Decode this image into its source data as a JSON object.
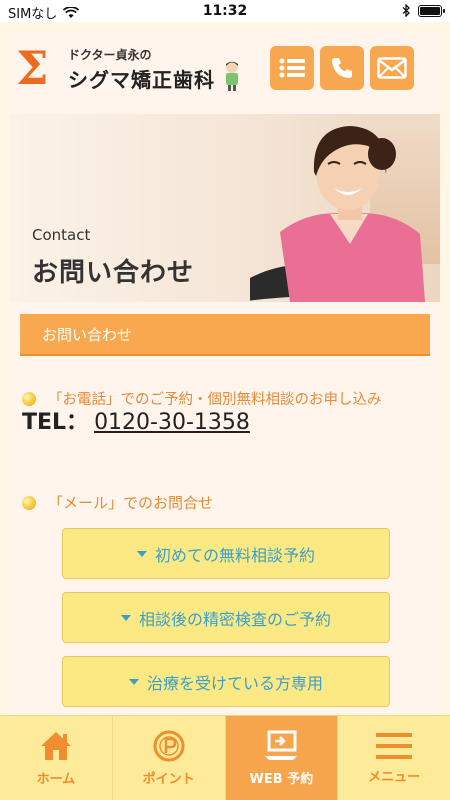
{
  "status": {
    "carrier": "SIMなし",
    "time": "11:32",
    "battery_level": 1.0
  },
  "header": {
    "logo_symbol": "Σ",
    "logo_sub": "ドクター貞永の",
    "logo_main": "シグマ矯正歯科",
    "buttons": [
      {
        "icon": "list-icon"
      },
      {
        "icon": "phone-icon"
      },
      {
        "icon": "mail-icon"
      }
    ]
  },
  "hero": {
    "title_en": "Contact",
    "title_jp": "お問い合わせ"
  },
  "section": {
    "title": "お問い合わせ"
  },
  "phone_section": {
    "heading": "「お電話」でのご予約・個別無料相談のお申し込み",
    "tel_label": "TEL：",
    "tel_number": "0120-30-1358"
  },
  "mail_section": {
    "heading": "「メール」でのお問合せ",
    "buttons": [
      {
        "label": "初めての無料相談予約"
      },
      {
        "label": "相談後の精密検査のご予約"
      },
      {
        "label": "治療を受けている方専用"
      }
    ]
  },
  "bottom_nav": {
    "items": [
      {
        "label": "ホーム",
        "icon": "home-icon"
      },
      {
        "label": "ポイント",
        "icon": "point-icon"
      },
      {
        "label": "WEB 予約",
        "icon": "web-reserve-icon",
        "active": true
      },
      {
        "label": "メニュー",
        "icon": "menu-icon"
      }
    ]
  },
  "colors": {
    "accent": "#f7a750",
    "brand": "#ee6a1f",
    "button_bg": "#fde984",
    "button_text": "#3aa0c8",
    "nav_bg": "#fdeb9a"
  }
}
